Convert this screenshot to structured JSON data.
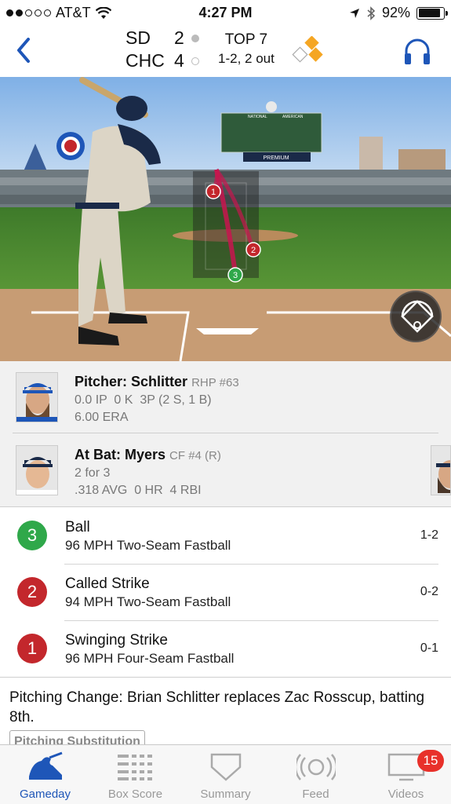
{
  "status_bar": {
    "carrier": "AT&T",
    "time": "4:27 PM",
    "battery": "92%",
    "signal_bars_on": 2,
    "signal_bars_total": 5
  },
  "header": {
    "teams": [
      {
        "abbr": "SD",
        "runs": "2",
        "batting": true
      },
      {
        "abbr": "CHC",
        "runs": "4",
        "batting": false
      }
    ],
    "inning": "TOP 7",
    "count": "1-2, 2 out",
    "accent_color": "#1e56b8",
    "base_color": "#f5a623"
  },
  "pitcher": {
    "name": "Pitcher: Schlitter",
    "meta": "RHP #63",
    "line1": "0.0 IP  0 K  3P (2 S, 1 B)",
    "line2": "6.00 ERA"
  },
  "batter": {
    "name": "At Bat: Myers",
    "meta": "CF #4 (R)",
    "line1": "2 for 3",
    "line2": ".318 AVG  0 HR  4 RBI"
  },
  "pitches": [
    {
      "num": "3",
      "result": "Ball",
      "desc": "96 MPH Two-Seam Fastball",
      "count": "1-2",
      "color": "green"
    },
    {
      "num": "2",
      "result": "Called Strike",
      "desc": "94 MPH Two-Seam Fastball",
      "count": "0-2",
      "color": "red"
    },
    {
      "num": "1",
      "result": "Swinging Strike",
      "desc": "96 MPH Four-Seam Fastball",
      "count": "0-1",
      "color": "red"
    }
  ],
  "event": {
    "text": "Pitching Change: Brian Schlitter replaces Zac Rosscup, batting 8th.",
    "tag": "Pitching Substitution"
  },
  "tabs": [
    {
      "label": "Gameday",
      "icon": "batter-logo-icon",
      "active": true
    },
    {
      "label": "Box Score",
      "icon": "box-score-icon",
      "active": false
    },
    {
      "label": "Summary",
      "icon": "home-plate-icon",
      "active": false
    },
    {
      "label": "Feed",
      "icon": "baseball-feed-icon",
      "active": false
    },
    {
      "label": "Videos",
      "icon": "tv-icon",
      "active": false,
      "badge": "15"
    }
  ],
  "field_overlay": {
    "pitch_markers": [
      "1",
      "2",
      "3"
    ],
    "scoreboard_text": [
      "NATIONAL",
      "AMERICAN"
    ],
    "banner_text": "PREMIUM"
  }
}
